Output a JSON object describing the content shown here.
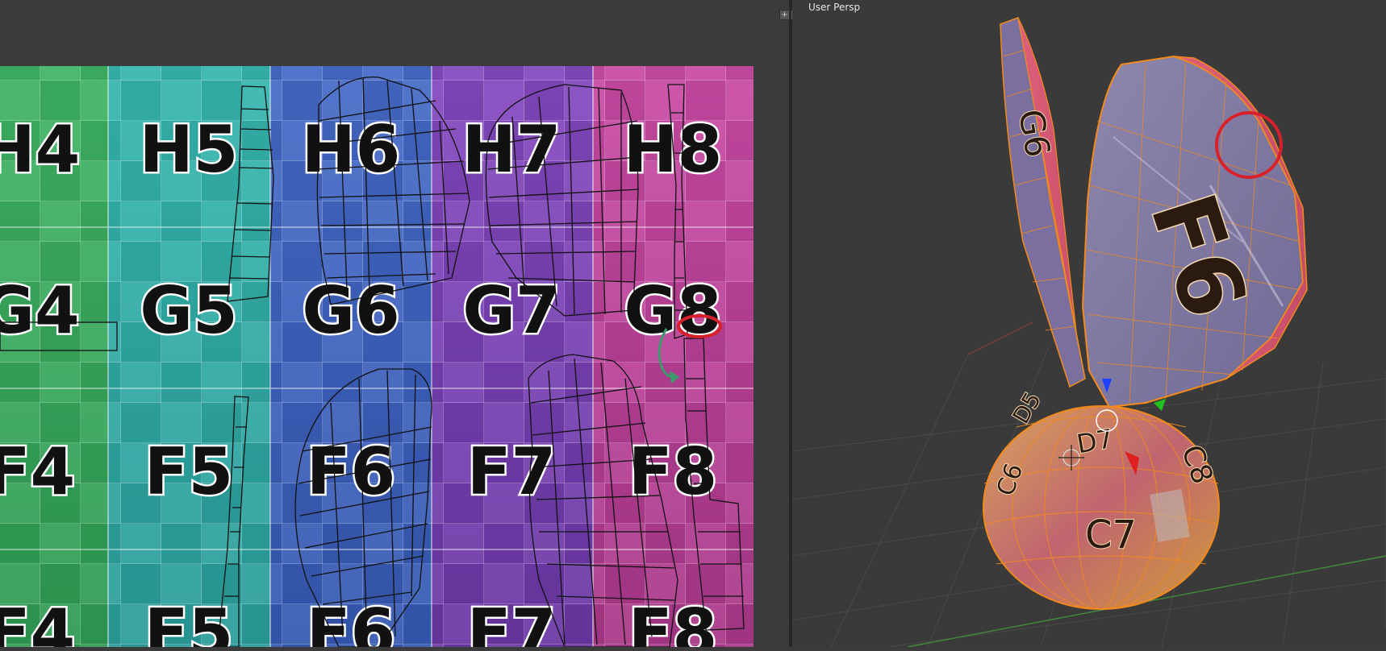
{
  "uv_editor": {
    "grid_labels": [
      {
        "id": "h4",
        "text": "H4"
      },
      {
        "id": "h5",
        "text": "H5"
      },
      {
        "id": "h6",
        "text": "H6"
      },
      {
        "id": "h7",
        "text": "H7"
      },
      {
        "id": "h8",
        "text": "H8"
      },
      {
        "id": "g4",
        "text": "G4"
      },
      {
        "id": "g5",
        "text": "G5"
      },
      {
        "id": "g6",
        "text": "G6"
      },
      {
        "id": "g7",
        "text": "G7"
      },
      {
        "id": "g8",
        "text": "G8"
      },
      {
        "id": "f4a",
        "text": "F4"
      },
      {
        "id": "f5a",
        "text": "F5"
      },
      {
        "id": "f6a",
        "text": "F6"
      },
      {
        "id": "f7a",
        "text": "F7"
      },
      {
        "id": "f8a",
        "text": "F8"
      },
      {
        "id": "f4b",
        "text": "F4"
      },
      {
        "id": "f5b",
        "text": "F5"
      },
      {
        "id": "f6b",
        "text": "F6"
      },
      {
        "id": "f7b",
        "text": "F7"
      },
      {
        "id": "f8b",
        "text": "F8"
      }
    ],
    "column_colors": [
      "#3aaa5c",
      "#2fb0aa",
      "#3d66c2",
      "#7a44b8",
      "#c246a0"
    ],
    "annotation_color": "#d8202a",
    "arrow_color": "#3a9a6a"
  },
  "viewport": {
    "view_label": "User Persp",
    "object_labels": {
      "large_face": "F6",
      "side_face": "G6",
      "bottom": "C7",
      "lower_mid": "D7",
      "side_small": "C8",
      "left_small": "D5",
      "left_lower": "C6"
    },
    "selection_color": "#f28a1c",
    "annotation_color": "#d8202a"
  },
  "split_widget": {
    "left_glyph": "+",
    "right_glyph": "+"
  }
}
